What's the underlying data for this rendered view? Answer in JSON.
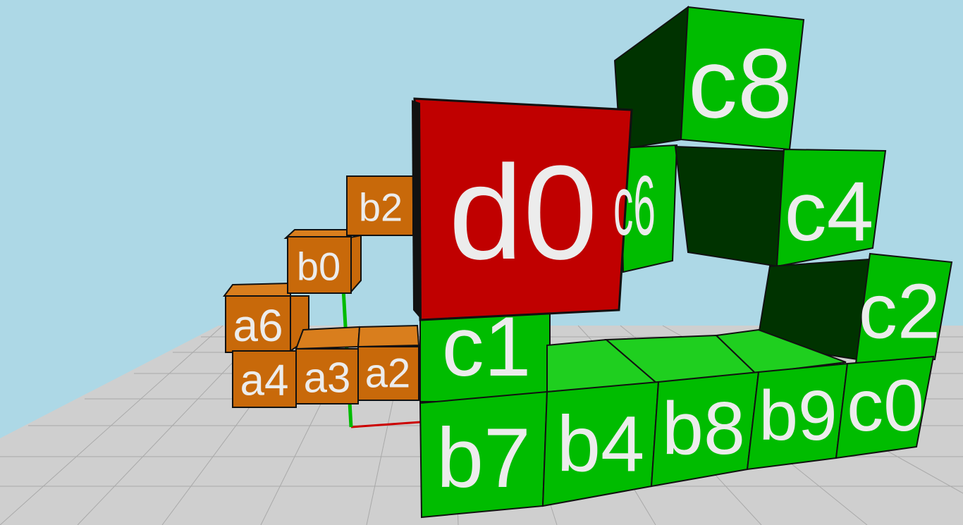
{
  "colors": {
    "sky": "#add8e6",
    "floor": "#cfcfcf",
    "grid_line": "#a8a8a8",
    "orange": "#c8690a",
    "orange_light": "#d97e1d",
    "green": "#00bc00",
    "green_light": "#1fcf1f",
    "green_dark": "#003300",
    "red": "#c00000",
    "label": "#ececec",
    "edge": "#111111",
    "axis_y": "#00bb00",
    "axis_x": "#cc0000"
  },
  "blocks": [
    {
      "label": "a6",
      "color": "orange"
    },
    {
      "label": "a4",
      "color": "orange"
    },
    {
      "label": "a3",
      "color": "orange"
    },
    {
      "label": "a2",
      "color": "orange"
    },
    {
      "label": "b0",
      "color": "orange"
    },
    {
      "label": "b2",
      "color": "orange"
    },
    {
      "label": "d0",
      "color": "red"
    },
    {
      "label": "c8",
      "color": "green"
    },
    {
      "label": "c4",
      "color": "green"
    },
    {
      "label": "c2",
      "color": "green"
    },
    {
      "label": "c1",
      "color": "green"
    },
    {
      "label": "c0",
      "color": "green"
    },
    {
      "label": "b7",
      "color": "green"
    },
    {
      "label": "b4",
      "color": "green"
    },
    {
      "label": "b8",
      "color": "green"
    },
    {
      "label": "b9",
      "color": "green"
    },
    {
      "label": "c6",
      "color": "green"
    }
  ]
}
